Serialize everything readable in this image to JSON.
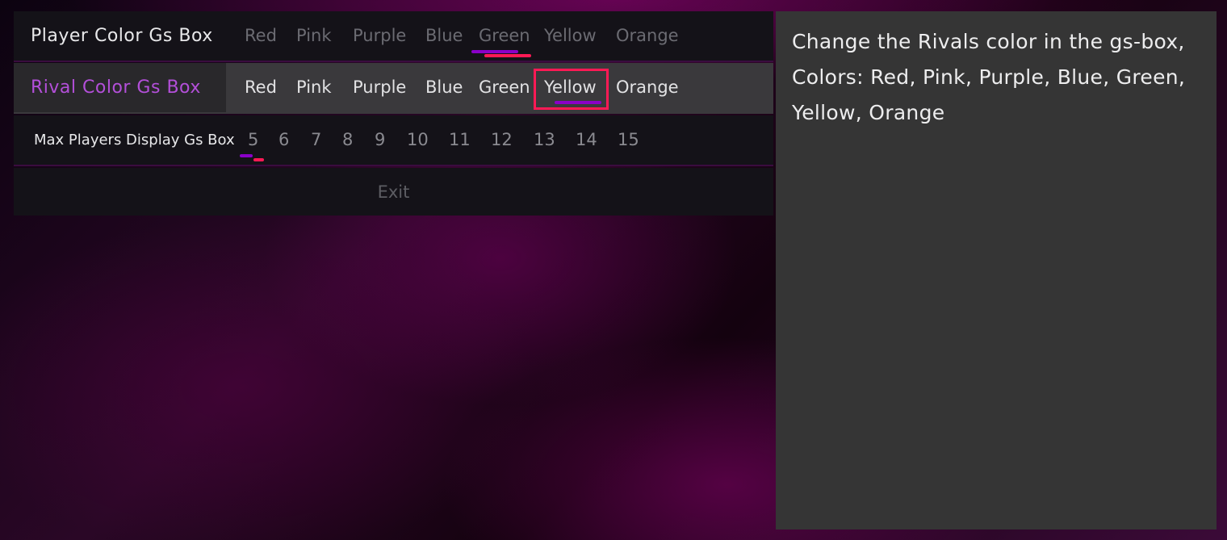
{
  "menu": {
    "player_color": {
      "label": "Player Color Gs Box",
      "options": [
        "Red",
        "Pink",
        "Purple",
        "Blue",
        "Green",
        "Yellow",
        "Orange"
      ],
      "selected": "Green"
    },
    "rival_color": {
      "label": "Rival Color Gs Box",
      "options": [
        "Red",
        "Pink",
        "Purple",
        "Blue",
        "Green",
        "Yellow",
        "Orange"
      ],
      "selected": "Yellow"
    },
    "max_players": {
      "label": "Max Players Display Gs Box",
      "options": [
        "5",
        "6",
        "7",
        "8",
        "9",
        "10",
        "11",
        "12",
        "13",
        "14",
        "15"
      ],
      "selected": "5"
    },
    "exit_label": "Exit"
  },
  "description": {
    "text": "Change the Rivals color in the gs-box, Colors: Red, Pink, Purple, Blue, Green, Yellow, Orange"
  },
  "colors": {
    "highlight_label": "#b34fd9",
    "selection_border": "#ff1a55",
    "underline_purple": "#8a00c8",
    "underline_pink": "#ff1a55"
  }
}
